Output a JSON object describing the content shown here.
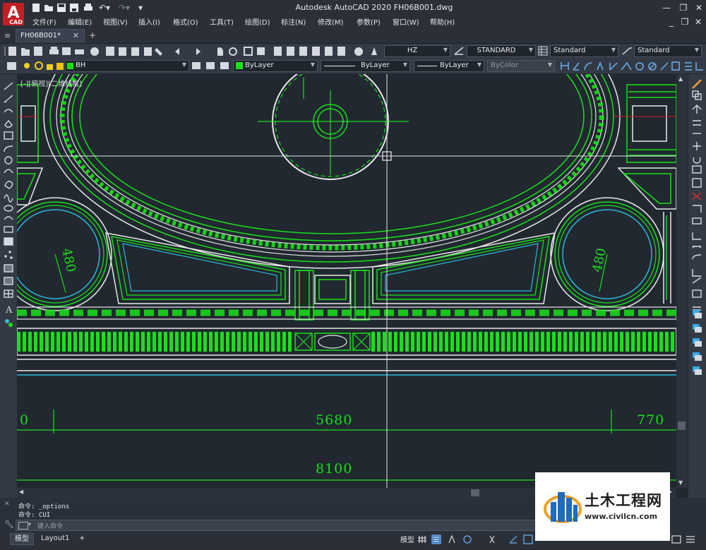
{
  "app": {
    "logo_text": "A",
    "logo_sub": "CAD",
    "title": "Autodesk AutoCAD 2020    FH06B001.dwg"
  },
  "menu": [
    "文件(F)",
    "编辑(E)",
    "视图(V)",
    "插入(I)",
    "格式(O)",
    "工具(T)",
    "绘图(D)",
    "标注(N)",
    "修改(M)",
    "参数(P)",
    "窗口(W)",
    "帮助(H)"
  ],
  "window_controls": {
    "minimize": "—",
    "restore": "❐",
    "close": "✕"
  },
  "doc_controls": {
    "minimize": "_",
    "restore": "❐",
    "close": "✕"
  },
  "tabs": {
    "document": "FH06B001*",
    "close": "✕",
    "add": "+"
  },
  "styles_toolbar": {
    "text_style": "HZ",
    "dim_style": "STANDARD",
    "table_style": "Standard",
    "multileader_style": "Standard"
  },
  "layers_toolbar": {
    "layer": "BH",
    "color": "ByLayer",
    "linetype": "ByLayer",
    "lineweight": "ByLayer",
    "plot_style": "ByColor"
  },
  "viewport_label": "[-][俯视][二维线框]",
  "drawing": {
    "dim_left_circle": "480",
    "dim_right_circle": "480",
    "dim_left_partial": "0",
    "dim_middle": "5680",
    "dim_right": "770",
    "dim_total": "8100"
  },
  "command_history": [
    "命令: _options",
    "命令: CUI"
  ],
  "command_placeholder": "键入命令",
  "layout_tabs": {
    "model": "模型",
    "layout1": "Layout1",
    "add": "+"
  },
  "status": {
    "model_label": "模型"
  },
  "watermark": {
    "title": "土木工程网",
    "url": "www.civilcn.com"
  },
  "colors": {
    "canvas": "#212830",
    "green": "#19e019",
    "white": "#e8e8e8",
    "cyan": "#2ab8d8",
    "red": "#d02020"
  }
}
